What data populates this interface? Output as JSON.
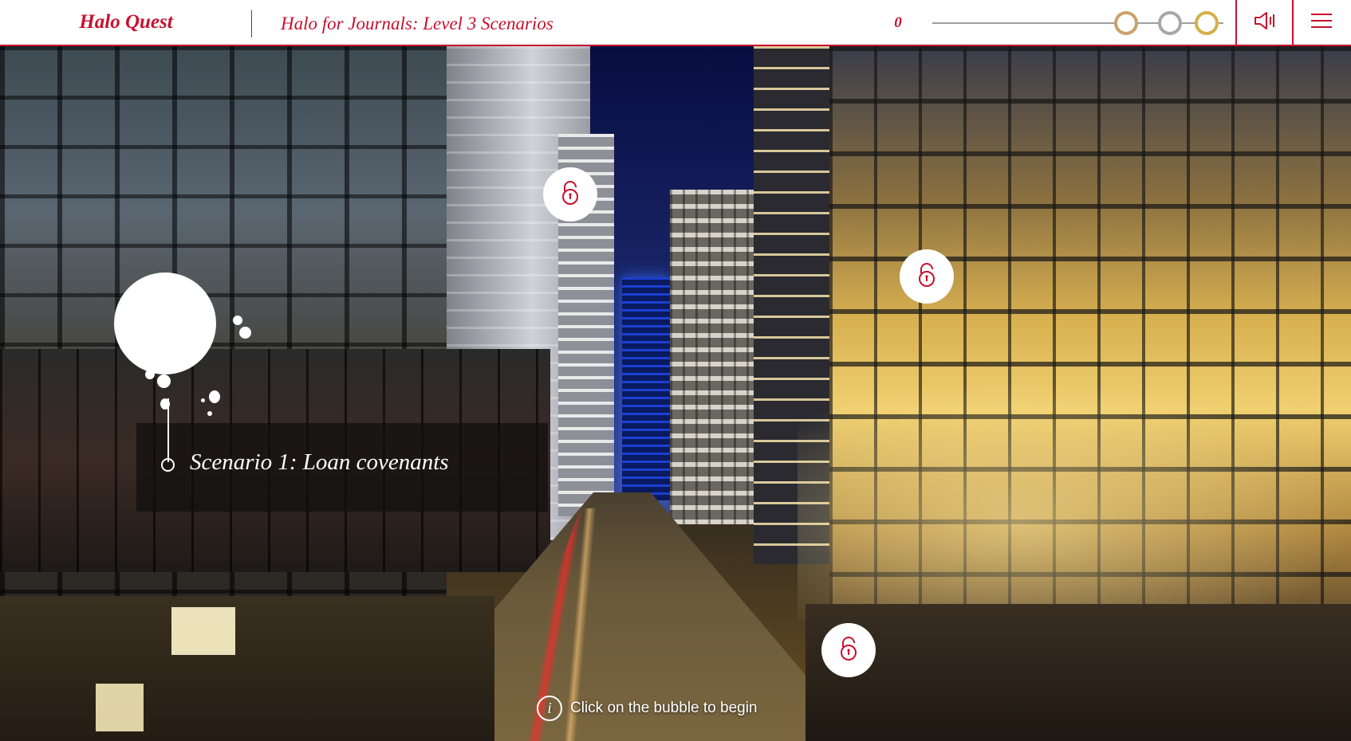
{
  "header": {
    "logo": "Halo Quest",
    "course_title": "Halo for Journals: Level 3 Scenarios",
    "score": "0",
    "medals": [
      "bronze-medal-icon",
      "silver-medal-icon",
      "gold-medal-icon"
    ],
    "audio_icon": "speaker-icon",
    "menu_icon": "hamburger-menu-icon"
  },
  "scene": {
    "background": "city-street-night-photo",
    "scenario_bubble": {
      "label": "Scenario 1: Loan covenants",
      "state": "unlocked"
    },
    "locked_bubbles": [
      {
        "icon": "unlock-icon"
      },
      {
        "icon": "unlock-icon"
      },
      {
        "icon": "unlock-icon"
      }
    ]
  },
  "hint": {
    "icon": "info-icon",
    "icon_glyph": "i",
    "text": "Click on the bubble to begin"
  },
  "colors": {
    "brand": "#c8102e",
    "header_bg": "#ffffff",
    "overlay": "#ffffff"
  }
}
